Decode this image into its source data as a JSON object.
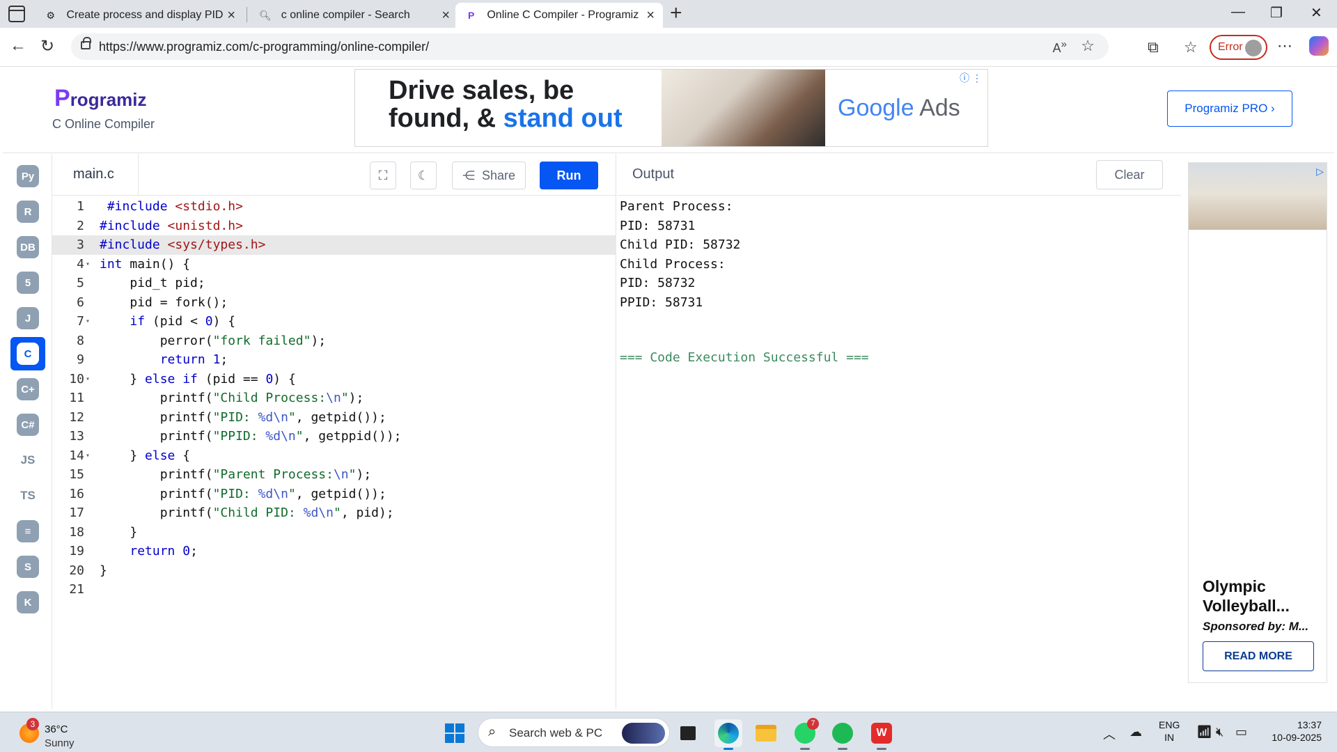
{
  "browser": {
    "tabs": [
      {
        "title": "Create process and display PID",
        "icon": "openai-icon"
      },
      {
        "title": "c online compiler - Search",
        "icon": "search-icon"
      },
      {
        "title": "Online C Compiler - Programiz",
        "icon": "programiz-icon",
        "active": true
      }
    ],
    "url": "https://www.programiz.com/c-programming/online-compiler/",
    "profile_status": "Error"
  },
  "header": {
    "logo": "rogramiz",
    "logo_initial": "P",
    "subtitle": "C Online Compiler",
    "pro_button": "Programiz PRO ›"
  },
  "top_ad": {
    "headline_1": "Drive sales, be",
    "headline_2": "found, & ",
    "headline_3": "stand out",
    "brand_google": "Google",
    "brand_ads": " Ads"
  },
  "rail": {
    "items": [
      {
        "name": "python",
        "label": "Py"
      },
      {
        "name": "r",
        "label": "R"
      },
      {
        "name": "sql",
        "label": "DB"
      },
      {
        "name": "html",
        "label": "5"
      },
      {
        "name": "java",
        "label": "J"
      },
      {
        "name": "c",
        "label": "C",
        "active": true
      },
      {
        "name": "cpp",
        "label": "C+"
      },
      {
        "name": "csharp",
        "label": "C#"
      },
      {
        "name": "js",
        "label": "JS",
        "text": true
      },
      {
        "name": "ts",
        "label": "TS",
        "text": true
      },
      {
        "name": "go",
        "label": "≡"
      },
      {
        "name": "swift",
        "label": "S"
      },
      {
        "name": "kotlin",
        "label": "K"
      }
    ]
  },
  "editor": {
    "filename": "main.c",
    "share_label": "Share",
    "run_label": "Run",
    "lines": [
      {
        "n": "1",
        "html": "<span class=\"kw\"> #include</span> <span class=\"str\">&lt;stdio.h&gt;</span>"
      },
      {
        "n": "2",
        "html": "<span class=\"kw\">#include</span> <span class=\"str\">&lt;unistd.h&gt;</span>"
      },
      {
        "n": "3",
        "html": "<span class=\"kw\">#include</span> <span class=\"str\">&lt;sys/types.h&gt;</span>",
        "hl": true
      },
      {
        "n": "4",
        "fold": true,
        "html": "<span class=\"kw\">int</span> main() {"
      },
      {
        "n": "5",
        "html": "    pid_t pid;"
      },
      {
        "n": "6",
        "html": "    pid = fork();"
      },
      {
        "n": "7",
        "fold": true,
        "html": "    <span class=\"kw\">if</span> (pid &lt; <span class=\"num\">0</span>) {"
      },
      {
        "n": "8",
        "html": "        perror(<span class=\"s2\">\"fork failed\"</span>);"
      },
      {
        "n": "9",
        "html": "        <span class=\"kw\">return</span> <span class=\"num\">1</span>;"
      },
      {
        "n": "10",
        "fold": true,
        "html": "    } <span class=\"kw\">else if</span> (pid == <span class=\"num\">0</span>) {"
      },
      {
        "n": "11",
        "html": "        printf(<span class=\"s2\">\"Child Process:</span><span class=\"esc\">\\n</span><span class=\"s2\">\"</span>);"
      },
      {
        "n": "12",
        "html": "        printf(<span class=\"s2\">\"PID: </span><span class=\"esc\">%d\\n</span><span class=\"s2\">\"</span>, getpid());"
      },
      {
        "n": "13",
        "html": "        printf(<span class=\"s2\">\"PPID: </span><span class=\"esc\">%d\\n</span><span class=\"s2\">\"</span>, getppid());"
      },
      {
        "n": "14",
        "fold": true,
        "html": "    } <span class=\"kw\">else</span> {"
      },
      {
        "n": "15",
        "html": "        printf(<span class=\"s2\">\"Parent Process:</span><span class=\"esc\">\\n</span><span class=\"s2\">\"</span>);"
      },
      {
        "n": "16",
        "html": "        printf(<span class=\"s2\">\"PID: </span><span class=\"esc\">%d\\n</span><span class=\"s2\">\"</span>, getpid());"
      },
      {
        "n": "17",
        "html": "        printf(<span class=\"s2\">\"Child PID: </span><span class=\"esc\">%d\\n</span><span class=\"s2\">\"</span>, pid);"
      },
      {
        "n": "18",
        "html": "    }"
      },
      {
        "n": "19",
        "html": "    <span class=\"kw\">return</span> <span class=\"num\">0</span>;"
      },
      {
        "n": "20",
        "html": "}"
      },
      {
        "n": "21",
        "html": ""
      }
    ]
  },
  "output": {
    "title": "Output",
    "clear_label": "Clear",
    "lines": [
      "Parent Process:",
      "PID: 58731",
      "Child PID: 58732",
      "Child Process:",
      "PID: 58732",
      "PPID: 58731"
    ],
    "success": "=== Code Execution Successful ==="
  },
  "side_ad": {
    "headline": "Olympic Volleyball...",
    "sponsor": "Sponsored by: M...",
    "cta": "READ MORE"
  },
  "taskbar": {
    "weather_badge": "3",
    "temperature": "36°C",
    "condition": "Sunny",
    "search_placeholder": "Search web & PC",
    "whatsapp_badge": "7",
    "language_1": "ENG",
    "language_2": "IN",
    "time": "13:37",
    "date": "10-09-2025"
  }
}
